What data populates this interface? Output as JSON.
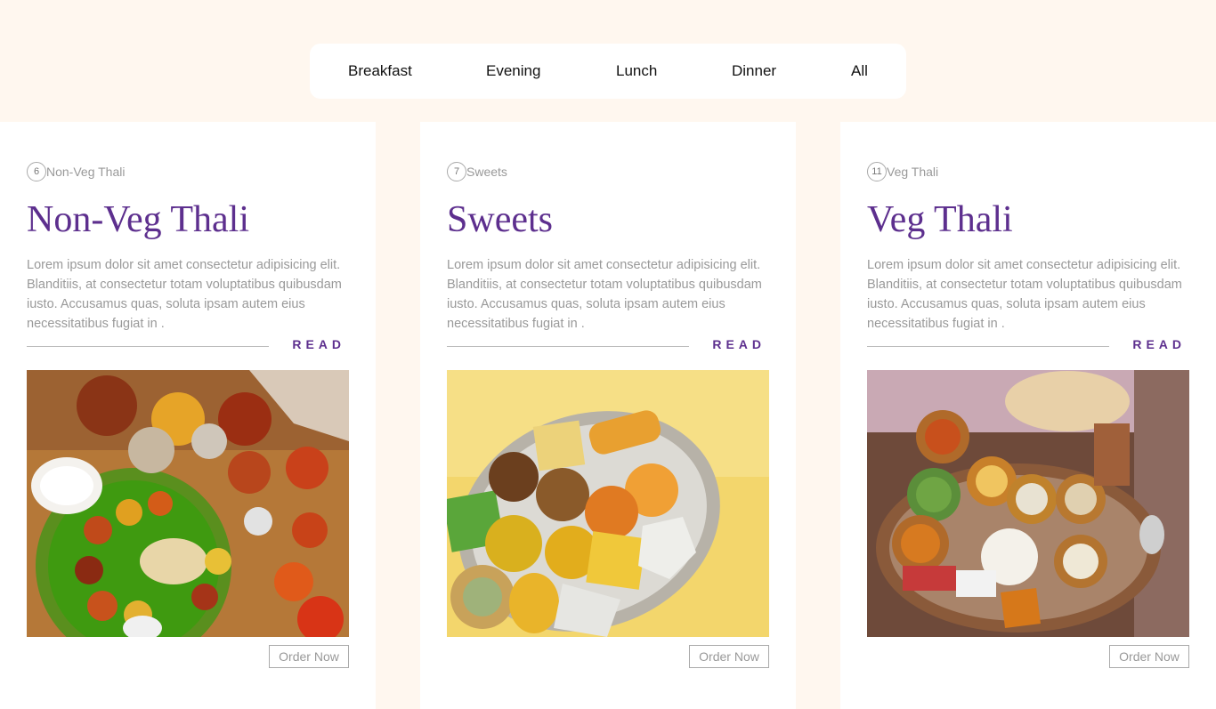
{
  "filters": [
    "Breakfast",
    "Evening",
    "Lunch",
    "Dinner",
    "All"
  ],
  "cards": [
    {
      "count": "6",
      "category": "Non-Veg Thali",
      "title": "Non-Veg Thali",
      "description": "Lorem ipsum dolor sit amet consectetur adipisicing elit. Blanditiis, at consectetur totam voluptatibus quibusdam iusto. Accusamus quas, soluta ipsam autem eius necessitatibus fugiat in .",
      "read_label": "READ",
      "order_label": "Order Now"
    },
    {
      "count": "7",
      "category": "Sweets",
      "title": "Sweets",
      "description": "Lorem ipsum dolor sit amet consectetur adipisicing elit. Blanditiis, at consectetur totam voluptatibus quibusdam iusto. Accusamus quas, soluta ipsam autem eius necessitatibus fugiat in .",
      "read_label": "READ",
      "order_label": "Order Now"
    },
    {
      "count": "11",
      "category": "Veg Thali",
      "title": "Veg Thali",
      "description": "Lorem ipsum dolor sit amet consectetur adipisicing elit. Blanditiis, at consectetur totam voluptatibus quibusdam iusto. Accusamus quas, soluta ipsam autem eius necessitatibus fugiat in .",
      "read_label": "READ",
      "order_label": "Order Now"
    }
  ],
  "colors": {
    "page_bg": "#fff7ef",
    "accent": "#5d2f8e",
    "muted_text": "#999999"
  }
}
